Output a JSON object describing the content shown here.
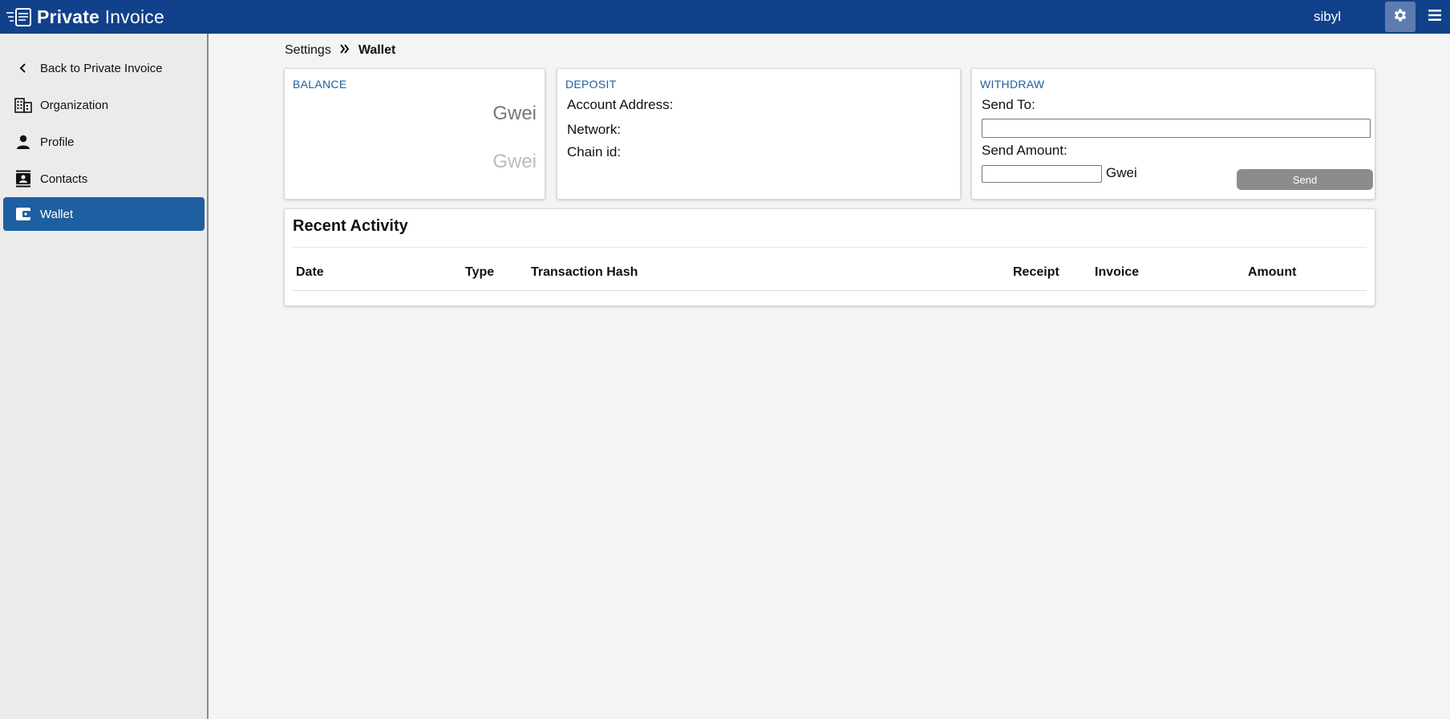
{
  "app": {
    "name_bold": "Private",
    "name_rest": " Invoice",
    "user": "sibyl"
  },
  "colors": {
    "topbar": "#11418a",
    "active_nav": "#1d5fa0",
    "card_title": "#1d5fa0",
    "send_button": "#8c8c8c"
  },
  "sidebar": {
    "items": [
      {
        "label": "Back to Private Invoice",
        "icon": "chevron-left-icon"
      },
      {
        "label": "Organization",
        "icon": "building-icon"
      },
      {
        "label": "Profile",
        "icon": "person-icon"
      },
      {
        "label": "Contacts",
        "icon": "contacts-icon"
      },
      {
        "label": "Wallet",
        "icon": "wallet-icon",
        "active": true
      }
    ]
  },
  "breadcrumb": {
    "parent": "Settings",
    "current": "Wallet"
  },
  "balance": {
    "title": "BALANCE",
    "line1": "Gwei",
    "line2": "Gwei"
  },
  "deposit": {
    "title": "DEPOSIT",
    "account_label": "Account Address:",
    "network_label": "Network:",
    "chain_label": "Chain id:"
  },
  "withdraw": {
    "title": "WITHDRAW",
    "send_to_label": "Send To:",
    "send_to_value": "",
    "send_amount_label": "Send Amount:",
    "send_amount_value": "",
    "unit": "Gwei",
    "send_button": "Send"
  },
  "activity": {
    "title": "Recent Activity",
    "columns": [
      "Date",
      "Type",
      "Transaction Hash",
      "Receipt",
      "Invoice",
      "Amount"
    ]
  }
}
